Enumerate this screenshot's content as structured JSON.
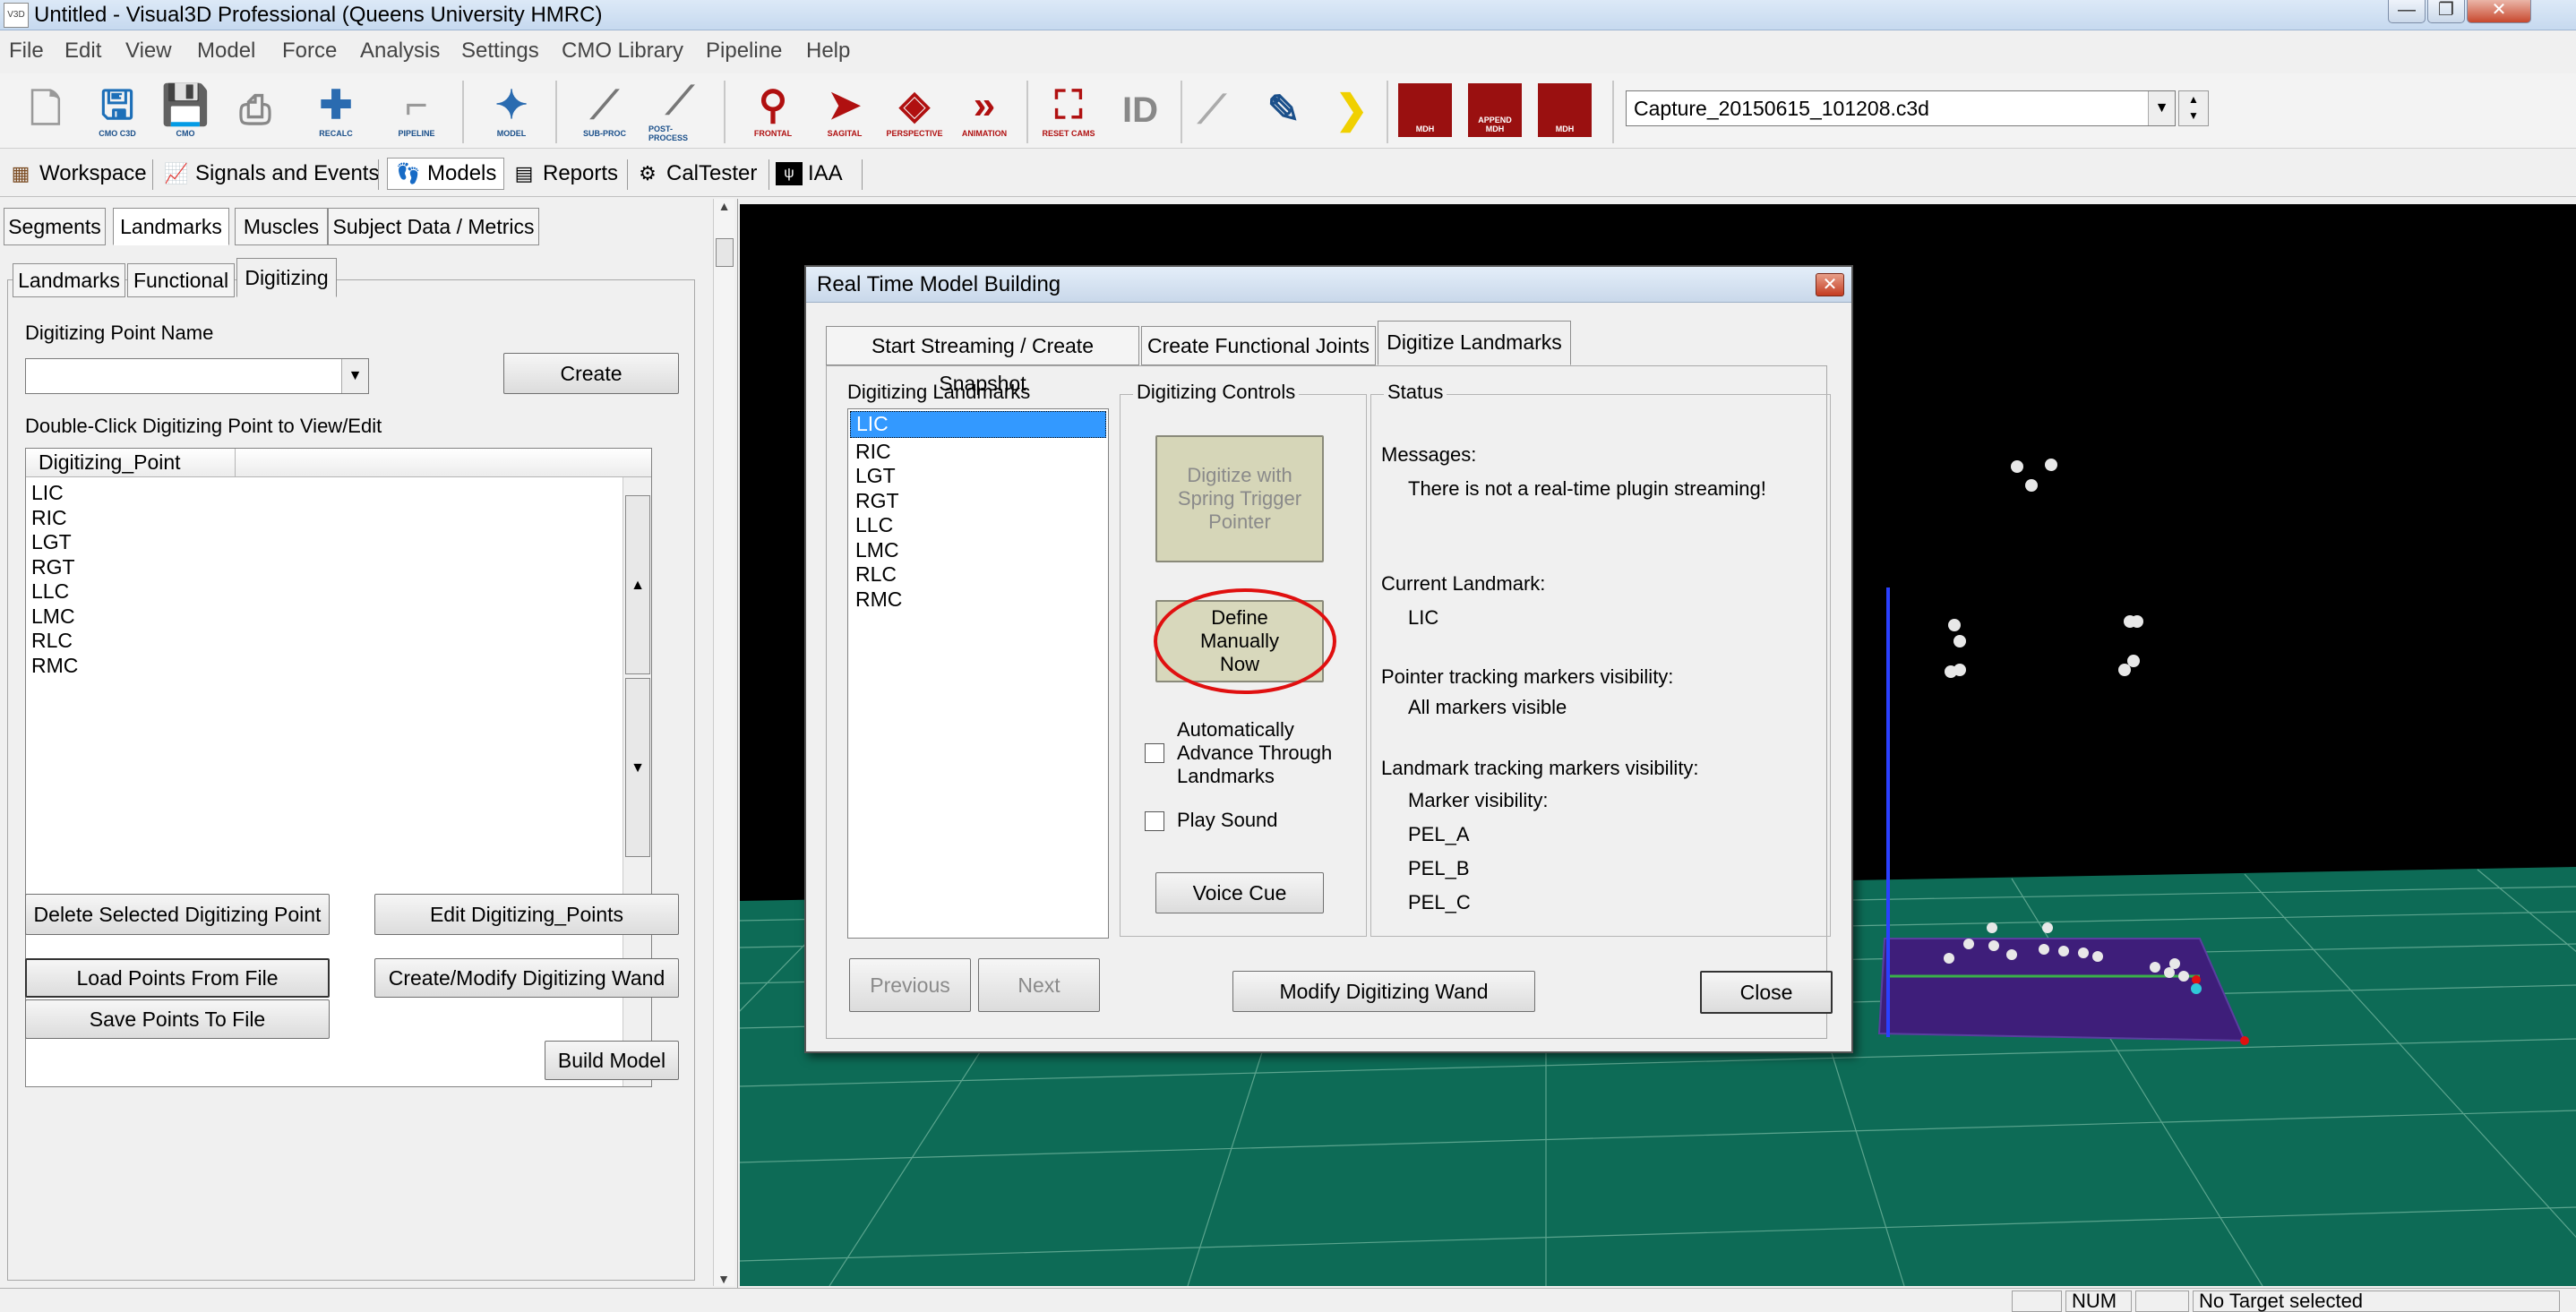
{
  "app": {
    "title": "Untitled - Visual3D Professional (Queens University HMRC)",
    "icon_label": "V3D"
  },
  "window_buttons": {
    "minimize": "—",
    "maximize": "❐",
    "close": "✕"
  },
  "menu": [
    "File",
    "Edit",
    "View",
    "Model",
    "Force",
    "Analysis",
    "Settings",
    "CMO Library",
    "Pipeline",
    "Help"
  ],
  "toolbar": {
    "buttons": [
      {
        "name": "new-file",
        "label": "",
        "icon": "new-file-icon"
      },
      {
        "name": "cmo-c3d",
        "label": "CMO C3D",
        "icon": "cmo-c3d-icon"
      },
      {
        "name": "save-cmo",
        "label": "CMO",
        "icon": "save-cmo-icon"
      },
      {
        "name": "print",
        "label": "",
        "icon": "print-icon"
      },
      {
        "name": "recalc",
        "label": "RECALC",
        "icon": "recalc-icon"
      },
      {
        "name": "pipeline",
        "label": "PIPELINE",
        "icon": "pipeline-icon"
      },
      {
        "name": "model",
        "label": "MODEL",
        "icon": "model-icon"
      },
      {
        "name": "sub-proc",
        "label": "SUB-PROC",
        "icon": "sub-proc-icon"
      },
      {
        "name": "post-process",
        "label": "POST-PROCESS",
        "icon": "post-process-icon"
      },
      {
        "name": "frontal",
        "label": "FRONTAL",
        "icon": "frontal-icon"
      },
      {
        "name": "sagittal",
        "label": "SAGITAL",
        "icon": "sagittal-icon"
      },
      {
        "name": "perspective",
        "label": "PERSPECTIVE",
        "icon": "perspective-icon"
      },
      {
        "name": "animation",
        "label": "ANIMATION",
        "icon": "animation-icon"
      },
      {
        "name": "reset-cams",
        "label": "RESET CAMS",
        "icon": "reset-cams-icon"
      },
      {
        "name": "id",
        "label": "ID",
        "icon": "id-icon"
      },
      {
        "name": "wand",
        "label": "",
        "icon": "wand-icon"
      },
      {
        "name": "pointer",
        "label": "",
        "icon": "pointer-icon"
      },
      {
        "name": "next",
        "label": "",
        "icon": "next-chevron-icon"
      },
      {
        "name": "mdh",
        "label": "MDH",
        "icon": "mdh-icon"
      },
      {
        "name": "append-mdh",
        "label": "APPEND MDH",
        "icon": "append-mdh-icon"
      },
      {
        "name": "save-mdh",
        "label": "MDH",
        "icon": "save-mdh-icon"
      }
    ],
    "file_combo": "Capture_20150615_101208.c3d"
  },
  "nav": [
    "Workspace",
    "Signals and Events",
    "Models",
    "Reports",
    "CalTester",
    "IAA"
  ],
  "left": {
    "tabs": [
      "Segments",
      "Landmarks",
      "Muscles",
      "Subject Data / Metrics"
    ],
    "subtabs": [
      "Landmarks",
      "Functional",
      "Digitizing"
    ],
    "digitizing_point_name_label": "Digitizing Point Name",
    "create_label": "Create",
    "dblclick_label": "Double-Click Digitizing Point to View/Edit",
    "column_header": "Digitizing_Point",
    "points": [
      "LIC",
      "RIC",
      "LGT",
      "RGT",
      "LLC",
      "LMC",
      "RLC",
      "RMC"
    ],
    "delete_label": "Delete Selected Digitizing Point",
    "edit_label": "Edit Digitizing_Points",
    "load_label": "Load Points From File",
    "wand_label": "Create/Modify Digitizing Wand",
    "save_label": "Save Points To File",
    "build_label": "Build Model"
  },
  "dialog": {
    "title": "Real Time Model Building",
    "tabs": [
      "Start Streaming / Create Snapshot",
      "Create Functional Joints",
      "Digitize Landmarks"
    ],
    "landmarks_group": "Digitizing Landmarks",
    "landmarks": [
      "LIC",
      "RIC",
      "LGT",
      "RGT",
      "LLC",
      "LMC",
      "RLC",
      "RMC"
    ],
    "controls_group": "Digitizing Controls",
    "digitize_btn": [
      "Digitize with",
      "Spring Trigger",
      "Pointer"
    ],
    "define_btn": [
      "Define",
      "Manually",
      "Now"
    ],
    "auto_advance": [
      "Automatically",
      "Advance Through",
      "Landmarks"
    ],
    "play_sound": "Play Sound",
    "voice_cue": "Voice Cue",
    "status_group": "Status",
    "messages_label": "Messages:",
    "message": "There is not a real-time plugin streaming!",
    "current_landmark_label": "Current Landmark:",
    "current_landmark": "LIC",
    "pointer_vis_label": "Pointer tracking markers visibility:",
    "pointer_vis": "All markers visible",
    "landmark_vis_label": "Landmark tracking markers visibility:",
    "marker_vis_label": "Marker visibility:",
    "markers": [
      "PEL_A",
      "PEL_B",
      "PEL_C"
    ],
    "previous": "Previous",
    "next": "Next",
    "modify_wand": "Modify Digitizing Wand",
    "close": "Close"
  },
  "status": {
    "num": "NUM",
    "target": "No Target selected"
  },
  "colors": {
    "floor": "#0d6b56",
    "platform": "#3e1e7a",
    "highlight": "#3399ff",
    "annotation": "#e01010"
  }
}
